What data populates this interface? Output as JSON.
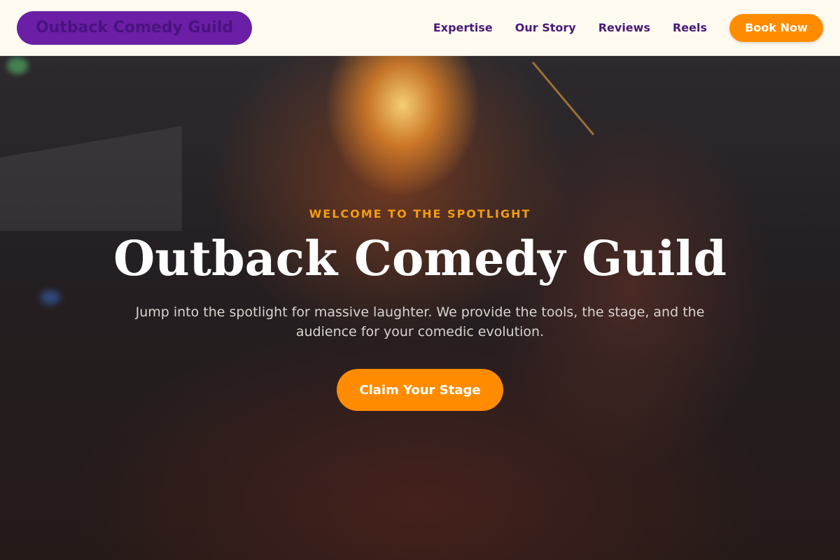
{
  "nav": {
    "logo": "Outback Comedy Guild",
    "links": [
      "Expertise",
      "Our Story",
      "Reviews",
      "Reels"
    ],
    "cta": "Book Now"
  },
  "hero": {
    "eyebrow": "WELCOME TO THE SPOTLIGHT",
    "title": "Outback Comedy Guild",
    "subtitle": "Jump into the spotlight for massive laughter. We provide the tools, the stage, and the audience for your comedic evolution.",
    "cta": "Claim Your Stage"
  },
  "colors": {
    "accent": "#ff8c00",
    "brand": "#6a1fa6",
    "nav_text": "#4a1a78",
    "eyebrow": "#f39c12"
  }
}
